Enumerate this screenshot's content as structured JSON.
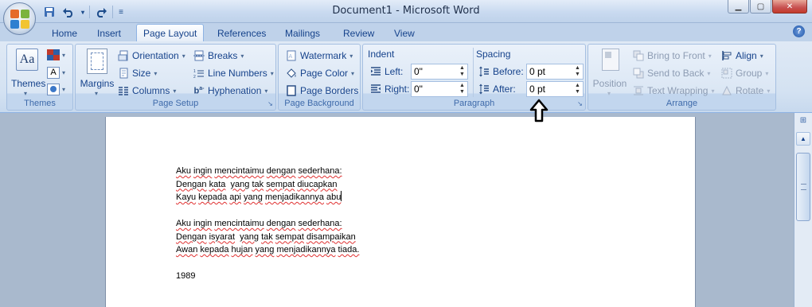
{
  "window": {
    "title": "Document1 - Microsoft Word",
    "minimize_glyph": "▁",
    "maximize_glyph": "▢",
    "close_glyph": "✕"
  },
  "quick_access": {
    "save_icon": "save-icon",
    "undo_icon": "undo-icon",
    "redo_icon": "redo-icon",
    "customize_icon": "customize-icon"
  },
  "tabs": [
    {
      "label": "Home"
    },
    {
      "label": "Insert"
    },
    {
      "label": "Page Layout",
      "active": true
    },
    {
      "label": "References"
    },
    {
      "label": "Mailings"
    },
    {
      "label": "Review"
    },
    {
      "label": "View"
    }
  ],
  "help": {
    "label": "?"
  },
  "ribbon": {
    "themes": {
      "group_label": "Themes",
      "themes_button": "Themes",
      "colors_icon": "theme-colors-icon",
      "fonts_label": "A",
      "effects_icon": "theme-effects-icon"
    },
    "page_setup": {
      "group_label": "Page Setup",
      "margins": "Margins",
      "orientation": "Orientation",
      "size": "Size",
      "columns": "Columns",
      "breaks": "Breaks",
      "line_numbers": "Line Numbers",
      "hyphenation": "Hyphenation"
    },
    "page_background": {
      "group_label": "Page Background",
      "watermark": "Watermark",
      "page_color": "Page Color",
      "page_borders": "Page Borders"
    },
    "paragraph": {
      "group_label": "Paragraph",
      "indent_heading": "Indent",
      "left_label": "Left:",
      "left_value": "0\"",
      "right_label": "Right:",
      "right_value": "0\"",
      "spacing_heading": "Spacing",
      "before_label": "Before:",
      "before_value": "0 pt",
      "after_label": "After:",
      "after_value": "0 pt"
    },
    "arrange": {
      "group_label": "Arrange",
      "position": "Position",
      "bring_to_front": "Bring to Front",
      "send_to_back": "Send to Back",
      "text_wrapping": "Text Wrapping",
      "align": "Align",
      "group": "Group",
      "rotate": "Rotate"
    }
  },
  "document": {
    "lines": [
      "Aku ingin mencintaimu dengan sederhana:",
      "Dengan kata  yang tak sempat diucapkan",
      "Kayu kepada api yang menjadikannya abu",
      "",
      "Aku ingin mencintaimu dengan sederhana:",
      "Dengan isyarat  yang tak sempat disampaikan",
      "Awan kepada hujan yang menjadikannya tiada.",
      "",
      "1989"
    ]
  },
  "colors": {
    "ribbon_text": "#15428b",
    "group_label": "#3e6aaa",
    "spell_error": "#e03030",
    "workspace": "#a9b9cd"
  }
}
